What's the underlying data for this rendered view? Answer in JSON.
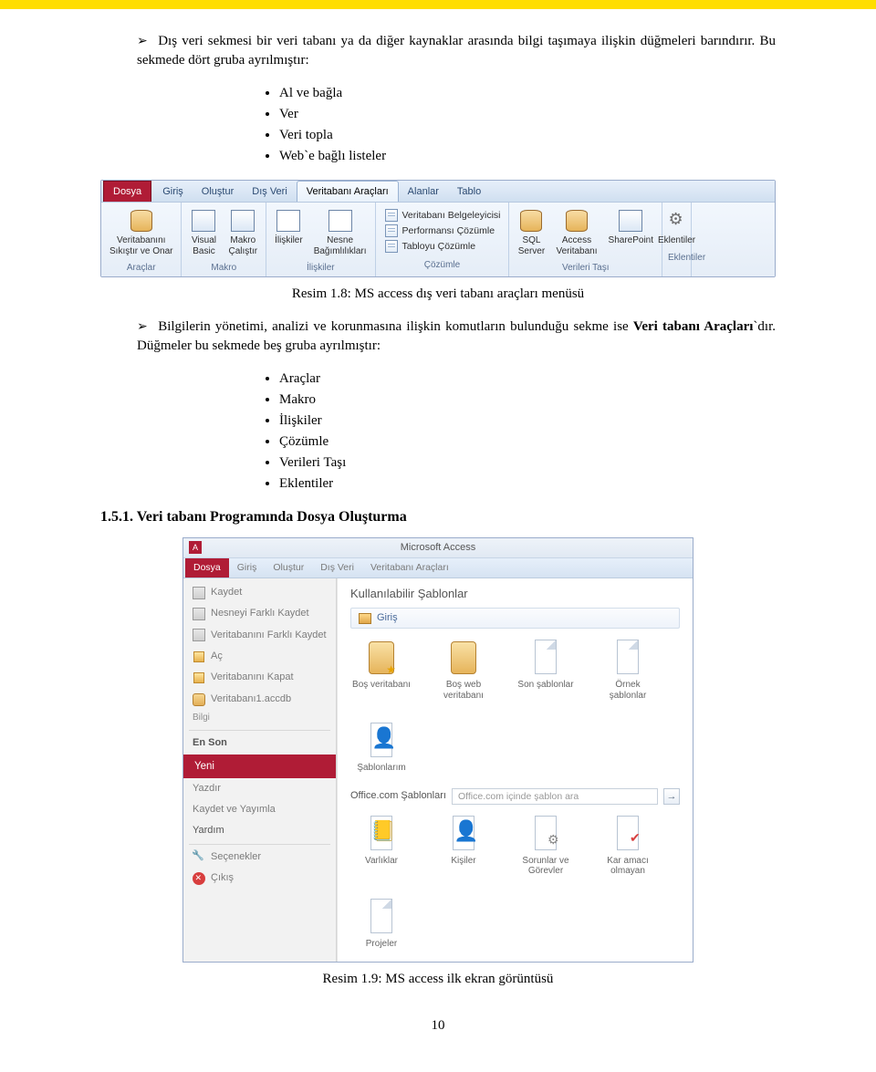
{
  "doc": {
    "para1": "Dış veri sekmesi bir veri tabanı ya da diğer kaynaklar arasında bilgi taşımaya ilişkin düğmeleri barındırır. Bu sekmede dört gruba ayrılmıştır:",
    "sublist1": [
      "Al ve bağla",
      "Ver",
      "Veri topla",
      "Web`e bağlı listeler"
    ],
    "caption1": "Resim 1.8: MS access dış veri tabanı araçları menüsü",
    "para2a": "Bilgilerin yönetimi, analizi ve korunmasına ilişkin komutların bulunduğu sekme ise ",
    "para2b": "Veri tabanı Araçları",
    "para2c": "`dır. Düğmeler bu sekmede beş gruba ayrılmıştır:",
    "sublist2": [
      "Araçlar",
      "Makro",
      "İlişkiler",
      "Çözümle",
      "Verileri Taşı",
      "Eklentiler"
    ],
    "heading": "1.5.1. Veri tabanı Programında Dosya Oluşturma",
    "caption2": "Resim 1.9: MS access ilk ekran görüntüsü",
    "pageNumber": "10"
  },
  "ribbon1": {
    "tabs": [
      "Dosya",
      "Giriş",
      "Oluştur",
      "Dış Veri",
      "Veritabanı Araçları",
      "Alanlar",
      "Tablo"
    ],
    "activeTab": "Veritabanı Araçları",
    "groups": {
      "araclar": {
        "btn1": "Veritabanını\nSıkıştır ve Onar",
        "label": "Araçlar"
      },
      "makro": {
        "btn1": "Visual\nBasic",
        "btn2": "Makro\nÇalıştır",
        "label": "Makro"
      },
      "iliskiler": {
        "btn1": "İlişkiler",
        "btn2": "Nesne\nBağımlılıkları",
        "label": "İlişkiler"
      },
      "cozumle": {
        "s1": "Veritabanı Belgeleyicisi",
        "s2": "Performansı Çözümle",
        "s3": "Tabloyu Çözümle",
        "label": "Çözümle"
      },
      "tasi": {
        "btn1": "SQL\nServer",
        "btn2": "Access\nVeritabanı",
        "btn3": "SharePoint",
        "label": "Verileri Taşı"
      },
      "eklenti": {
        "btn1": "Eklentiler",
        "label": "Eklentiler"
      }
    }
  },
  "access2": {
    "title": "Microsoft Access",
    "tabs": [
      "Dosya",
      "Giriş",
      "Oluştur",
      "Dış Veri",
      "Veritabanı Araçları"
    ],
    "left": {
      "kaydet": "Kaydet",
      "nesneKaydet": "Nesneyi Farklı Kaydet",
      "vtKaydet": "Veritabanını Farklı Kaydet",
      "ac": "Aç",
      "kapat": "Veritabanını Kapat",
      "recent": "Veritabanı1.accdb",
      "bilgi": "Bilgi",
      "enSon": "En Son",
      "yeni": "Yeni",
      "yazdir": "Yazdır",
      "kaydetYayimla": "Kaydet ve Yayımla",
      "yardim": "Yardım",
      "secenekler": "Seçenekler",
      "cikis": "Çıkış"
    },
    "right": {
      "heading": "Kullanılabilir Şablonlar",
      "home": "Giriş",
      "tilesTop": [
        "Boş veritabanı",
        "Boş web veritabanı",
        "Son şablonlar",
        "Örnek şablonlar",
        "Şablonlarım"
      ],
      "searchLabel": "Office.com Şablonları",
      "searchPlaceholder": "Office.com içinde şablon ara",
      "tilesBottom": [
        "Varlıklar",
        "Kişiler",
        "Sorunlar ve Görevler",
        "Kar amacı olmayan",
        "Projeler"
      ]
    }
  }
}
